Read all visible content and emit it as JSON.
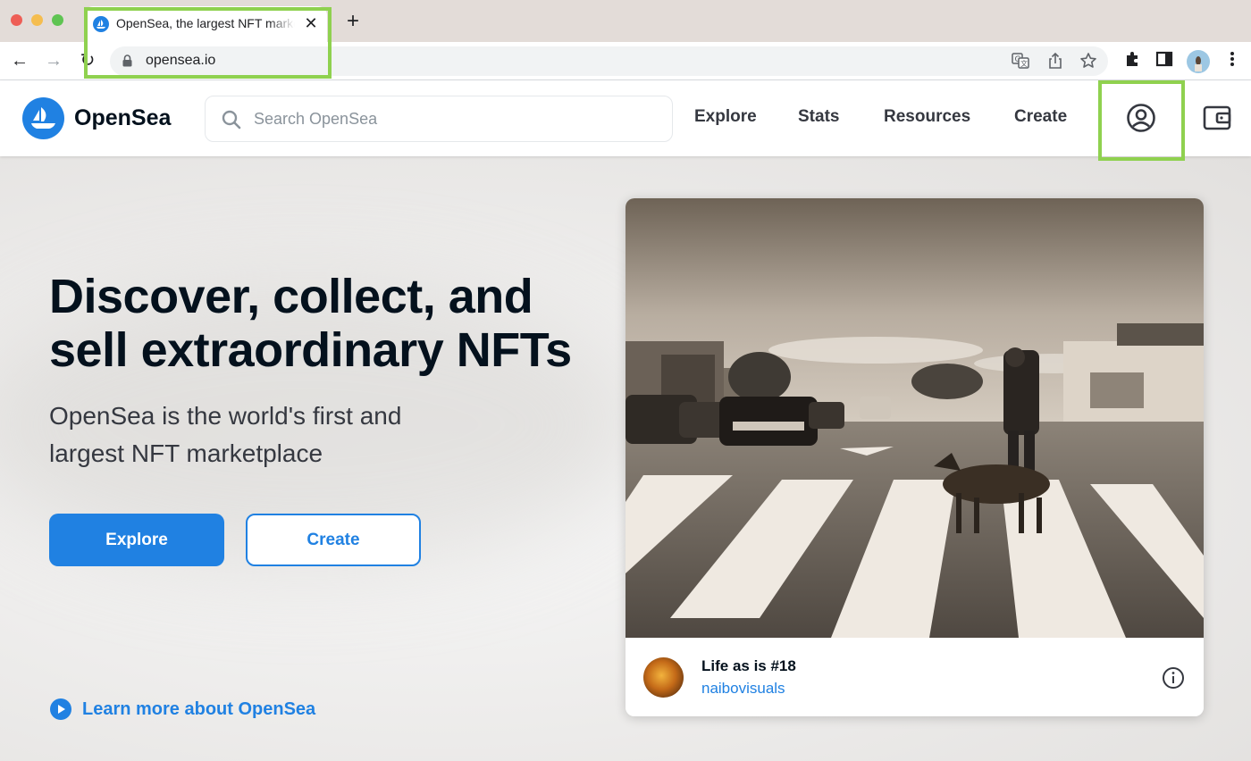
{
  "browser": {
    "tab_title": "OpenSea, the largest NFT marketplace",
    "tab_close": "✕",
    "new_tab": "+",
    "url": "opensea.io",
    "nav": {
      "back": "←",
      "forward": "→",
      "reload": "↻"
    },
    "icons": [
      "translate-icon",
      "share-icon",
      "bookmark-star-icon",
      "extensions-icon",
      "side-panel-icon",
      "profile-avatar",
      "menu-icon"
    ]
  },
  "header": {
    "brand": "OpenSea",
    "search_placeholder": "Search OpenSea",
    "nav": [
      "Explore",
      "Stats",
      "Resources",
      "Create"
    ],
    "icons": [
      "account-icon",
      "wallet-icon"
    ]
  },
  "hero": {
    "title": "Discover, collect, and sell extraordinary NFTs",
    "subtitle": "OpenSea is the world's first and largest NFT marketplace",
    "explore_label": "Explore",
    "create_label": "Create",
    "learn_more": "Learn more about OpenSea"
  },
  "featured": {
    "name": "Life as is #18",
    "creator": "naibovisuals"
  },
  "colors": {
    "accent": "#2081e2",
    "highlight": "#8fd14f",
    "text_dark": "#04111d"
  }
}
